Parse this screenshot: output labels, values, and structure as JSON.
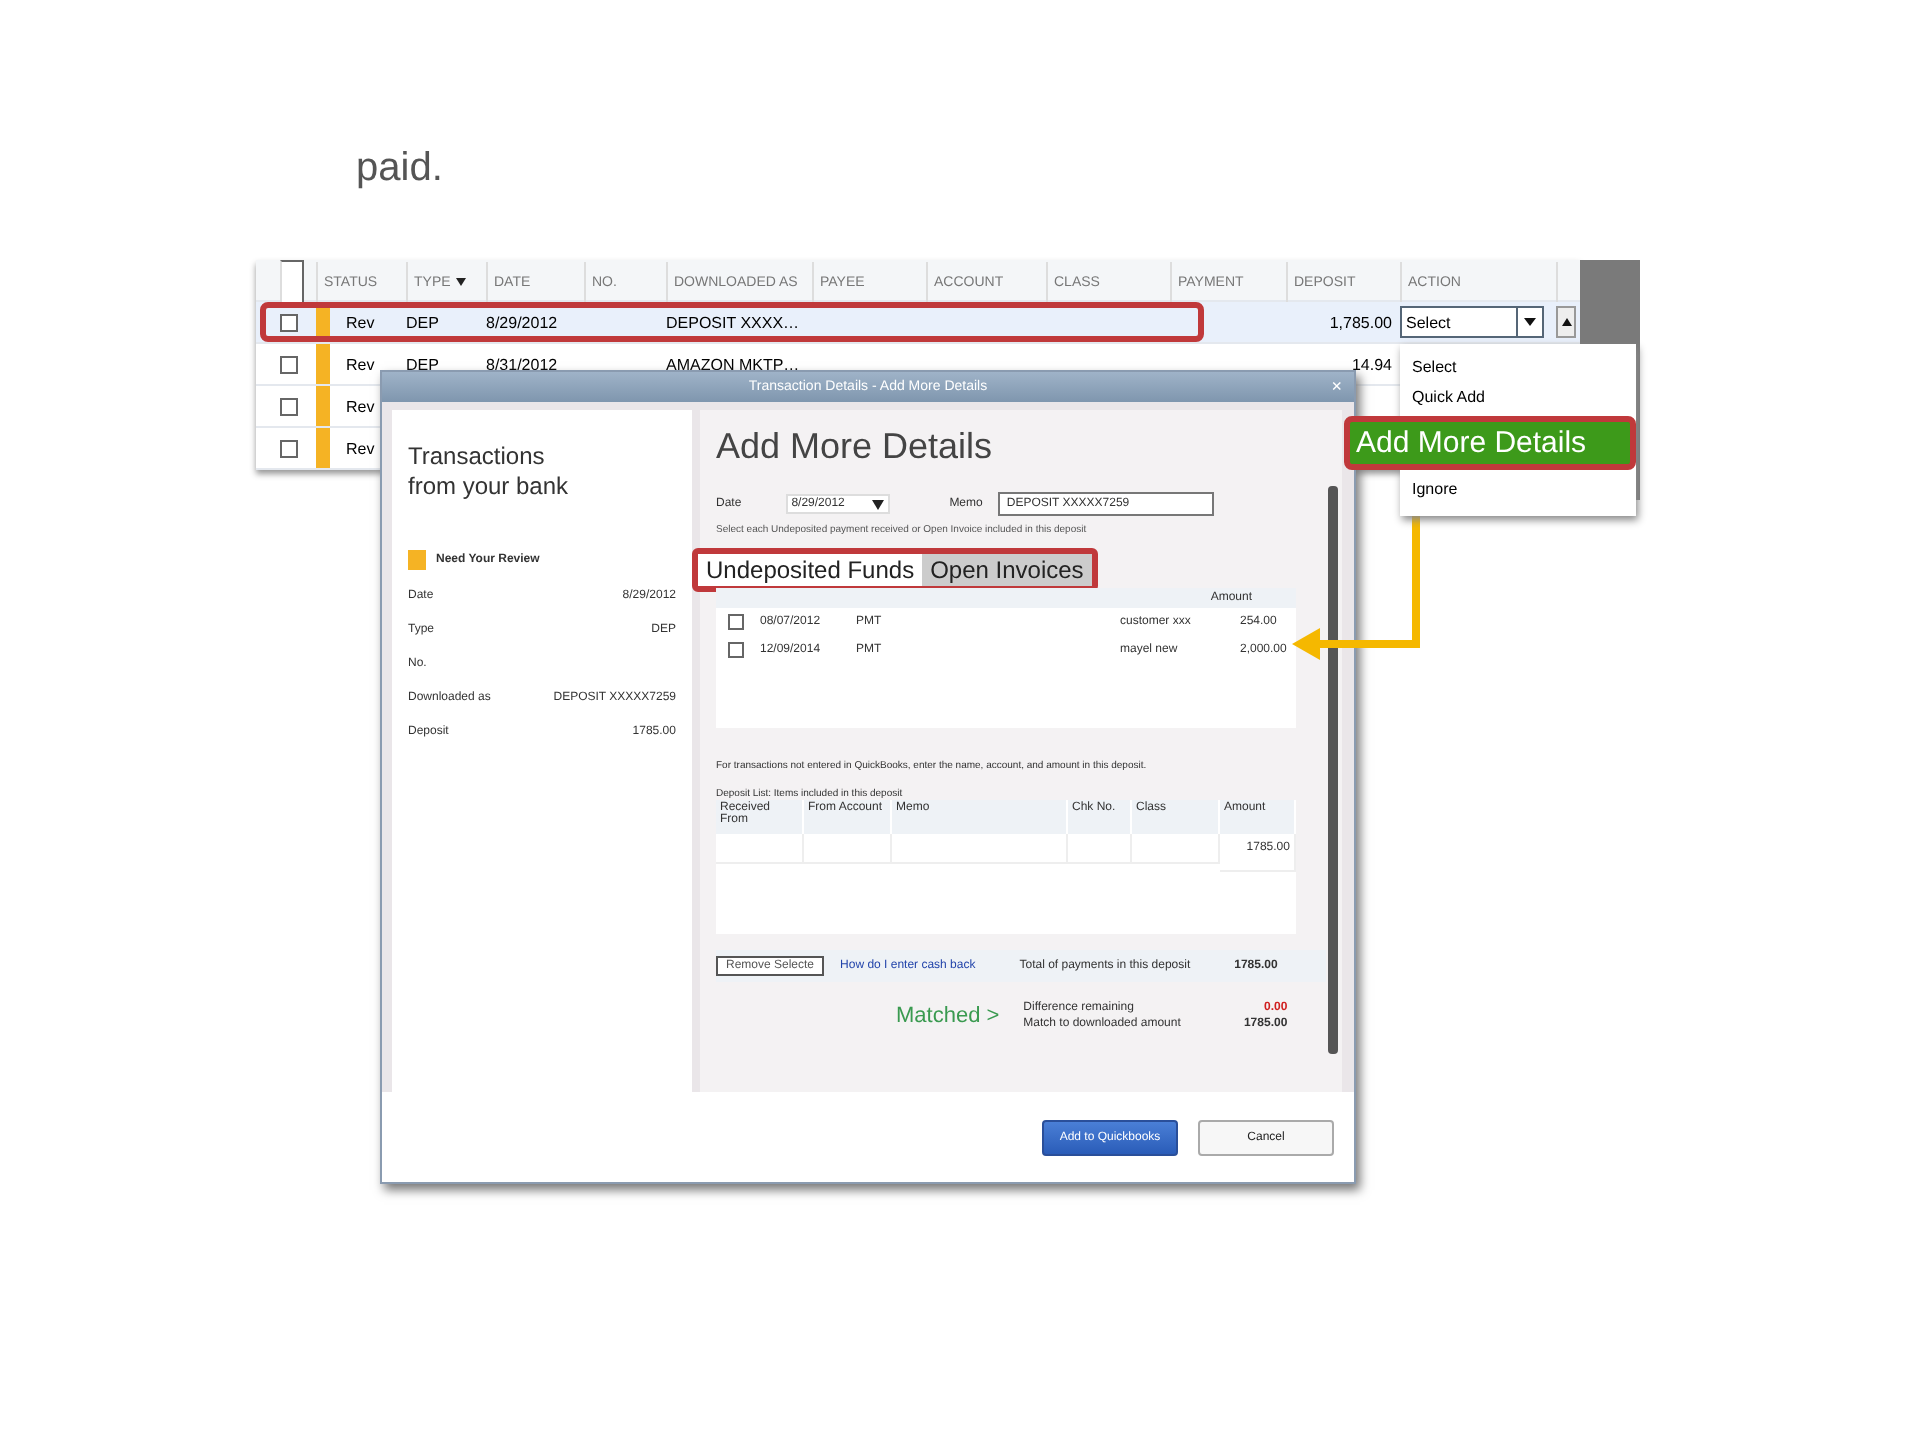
{
  "slide_text": "paid.",
  "register": {
    "columns": [
      "STATUS",
      "TYPE",
      "DATE",
      "NO.",
      "DOWNLOADED AS",
      "PAYEE",
      "ACCOUNT",
      "CLASS",
      "PAYMENT",
      "DEPOSIT",
      "ACTION"
    ],
    "all_checked": false,
    "rows": [
      {
        "checked": false,
        "status": "Rev",
        "type": "DEP",
        "date": "8/29/2012",
        "downloaded_as": "DEPOSIT XXXX…",
        "deposit": "1,785.00",
        "action": "Select",
        "outlined": true
      },
      {
        "checked": false,
        "status": "Rev",
        "type": "DEP",
        "date": "8/31/2012",
        "downloaded_as": "AMAZON MKTP…",
        "deposit": "14.94",
        "outlined": false
      },
      {
        "checked": false,
        "status": "Rev",
        "outlined": false
      },
      {
        "checked": false,
        "status": "Rev",
        "outlined": false
      }
    ]
  },
  "action_menu": [
    {
      "label": "Select",
      "selected": false
    },
    {
      "label": "Quick Add",
      "selected": false
    },
    {
      "label": "Add More Details",
      "selected": true
    },
    {
      "label": "Ignore",
      "selected": false
    }
  ],
  "dialog": {
    "title": "Transaction Details - Add More Details",
    "close": "×",
    "left": {
      "heading": "Transactions from your bank",
      "badge": "Need Your Review",
      "fields": [
        {
          "label": "Date",
          "value": "8/29/2012"
        },
        {
          "label": "Type",
          "value": "DEP"
        },
        {
          "label": "No."
        },
        {
          "label": "Downloaded as",
          "value": "DEPOSIT XXXXX7259"
        },
        {
          "label": "Deposit",
          "value": "1785.00"
        }
      ]
    },
    "heading": "Add More Details",
    "date_label": "Date",
    "date": "8/29/2012",
    "memo_label": "Memo",
    "memo": "DEPOSIT XXXXX7259",
    "instruction": "Select each Undeposited payment received or Open Invoice included in this deposit",
    "tabs": [
      {
        "label": "Undeposited Funds",
        "selected": true
      },
      {
        "label": "Open Invoices",
        "selected": false
      }
    ],
    "amount_heading": "Amount",
    "payments": [
      {
        "checked": false,
        "date": "08/07/2012",
        "type": "PMT",
        "name": "customer xxx",
        "amount": "254.00"
      },
      {
        "checked": false,
        "date": "12/09/2014",
        "type": "PMT",
        "name": "mayel new",
        "amount": "2,000.00"
      }
    ],
    "note": "For transactions not entered in QuickBooks, enter the name, account, and amount in this deposit.",
    "deposit_list_label": "Deposit List: Items included in this deposit",
    "deposit_columns": [
      "Received From",
      "From Account",
      "Memo",
      "Chk No.",
      "Class",
      "Amount"
    ],
    "deposit_amount": "1785.00",
    "remove_button": "Remove Selecte",
    "cash_back_link": "How do I enter cash back",
    "total_label": "Total of payments in this deposit",
    "total": "1785.00",
    "matched": "Matched >",
    "difference_label": "Difference remaining",
    "difference": "0.00",
    "match_label": "Match to downloaded amount",
    "match": "1785.00",
    "buttons": [
      {
        "label": "Add to Quickbooks",
        "kind": "primary"
      },
      {
        "label": "Cancel",
        "kind": "secondary"
      }
    ]
  }
}
